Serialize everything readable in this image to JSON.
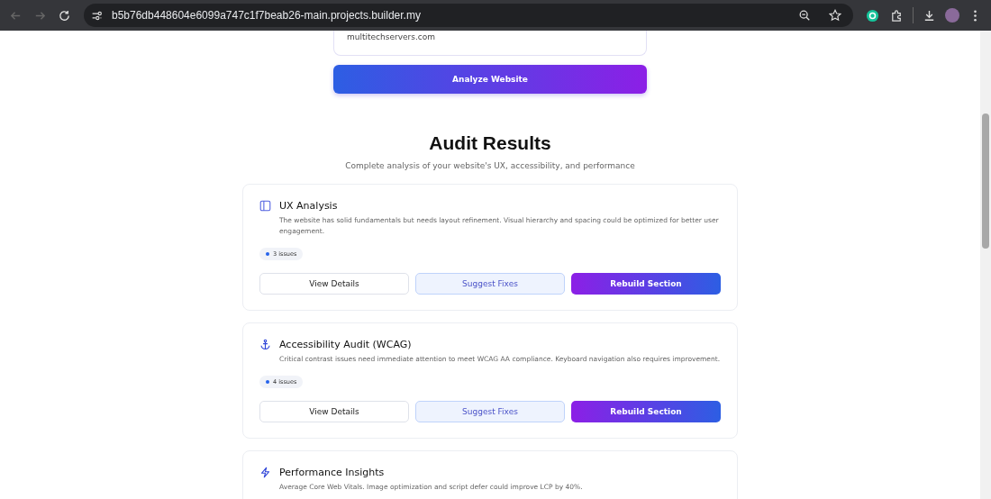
{
  "browser": {
    "url": "b5b76db448604e6099a747c1f7beab26-main.projects.builder.my"
  },
  "url_input": {
    "value": "multitechservers.com"
  },
  "analyze_button": "Analyze Website",
  "heading": "Audit Results",
  "subheading": "Complete analysis of your website's UX, accessibility, and performance",
  "cards": [
    {
      "kind": "layout",
      "title": "UX Analysis",
      "description": "The website has solid fundamentals but needs layout refinement. Visual hierarchy and spacing could be optimized for better user engagement.",
      "issues": "3 issues",
      "buttons": [
        "View Details",
        "Suggest Fixes",
        "Rebuild Section"
      ]
    },
    {
      "kind": "anchor",
      "title": "Accessibility Audit (WCAG)",
      "description": "Critical contrast issues need immediate attention to meet WCAG AA compliance. Keyboard navigation also requires improvement.",
      "issues": "4 issues",
      "buttons": [
        "View Details",
        "Suggest Fixes",
        "Rebuild Section"
      ]
    },
    {
      "kind": "bolt",
      "title": "Performance Insights",
      "description": "Average Core Web Vitals. Image optimization and script defer could improve LCP by 40%."
    }
  ]
}
